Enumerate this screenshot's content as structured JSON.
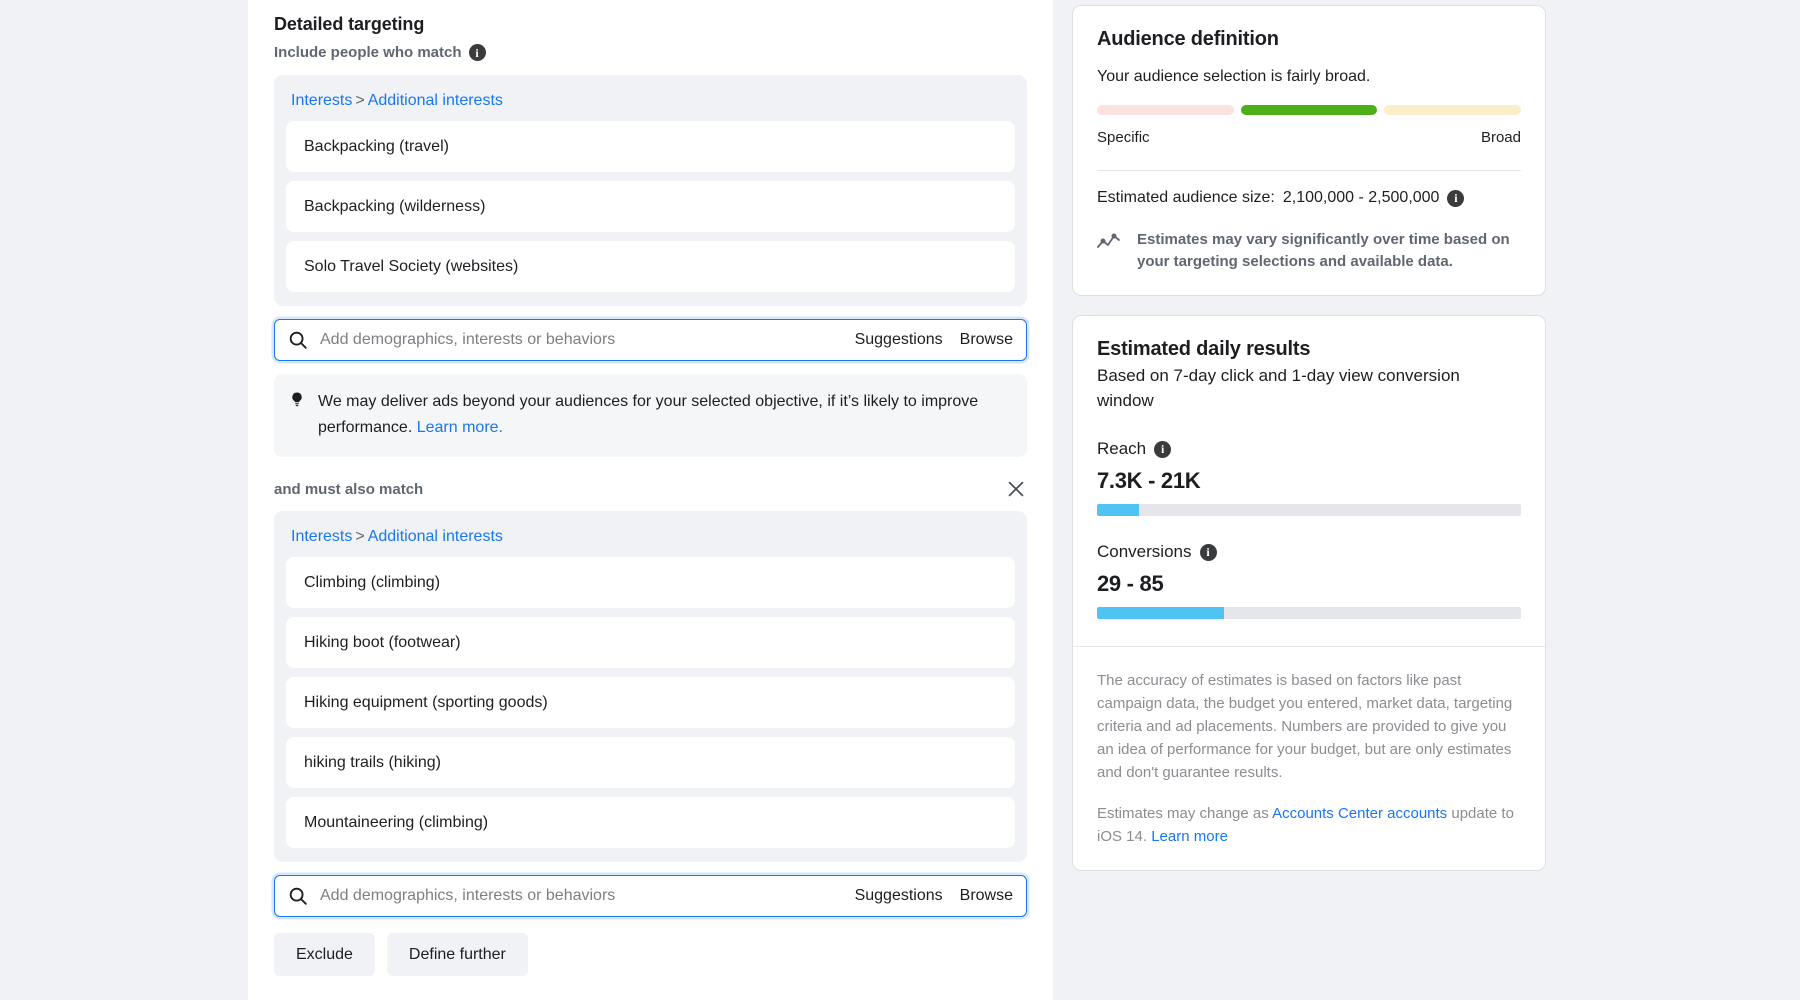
{
  "detailed_targeting": {
    "title": "Detailed targeting",
    "include_label": "Include people who match",
    "include_info_icon": "info-icon",
    "group1": {
      "breadcrumb_root": "Interests",
      "breadcrumb_sep": ">",
      "breadcrumb_leaf": "Additional interests",
      "items": [
        "Backpacking (travel)",
        "Backpacking (wilderness)",
        "Solo Travel Society (websites)"
      ],
      "search": {
        "icon": "search-icon",
        "placeholder": "Add demographics, interests or behaviors",
        "suggestions_label": "Suggestions",
        "browse_label": "Browse"
      }
    },
    "notice": {
      "icon": "lightbulb-icon",
      "text": "We may deliver ads beyond your audiences for your selected objective, if it’s likely to improve performance.",
      "link": "Learn more."
    },
    "and_must_also_match_label": "and must also match",
    "close_icon": "close-icon",
    "group2": {
      "breadcrumb_root": "Interests",
      "breadcrumb_sep": ">",
      "breadcrumb_leaf": "Additional interests",
      "items": [
        "Climbing (climbing)",
        "Hiking boot (footwear)",
        "Hiking equipment (sporting goods)",
        "hiking trails (hiking)",
        "Mountaineering (climbing)"
      ],
      "search": {
        "icon": "search-icon",
        "placeholder": "Add demographics, interests or behaviors",
        "suggestions_label": "Suggestions",
        "browse_label": "Browse"
      }
    },
    "buttons": {
      "exclude": "Exclude",
      "define_further": "Define further"
    }
  },
  "audience_definition": {
    "title": "Audience definition",
    "summary": "Your audience selection is fairly broad.",
    "meter": {
      "segments": [
        {
          "name": "specific",
          "color": "#fbe2e0",
          "active": false
        },
        {
          "name": "middle",
          "color": "#4caf17",
          "active": true
        },
        {
          "name": "broad",
          "color": "#fbeec8",
          "active": false
        }
      ],
      "left_label": "Specific",
      "right_label": "Broad"
    },
    "estimated_size_label": "Estimated audience size:",
    "estimated_size_value": "2,100,000 - 2,500,000",
    "estimated_size_info_icon": "info-icon",
    "vary_icon": "trend-chart-icon",
    "vary_text": "Estimates may vary significantly over time based on your targeting selections and available data."
  },
  "estimated_daily_results": {
    "title": "Estimated daily results",
    "subtitle": "Based on 7-day click and 1-day view conversion window",
    "metrics": [
      {
        "label": "Reach",
        "info_icon": "info-icon",
        "value": "7.3K - 21K",
        "fill_percent": 10,
        "fill_color": "#4fc3f1"
      },
      {
        "label": "Conversions",
        "info_icon": "info-icon",
        "value": "29 - 85",
        "fill_percent": 30,
        "fill_color": "#4fc3f1"
      }
    ],
    "accuracy_text": "The accuracy of estimates is based on factors like past campaign data, the budget you entered, market data, targeting criteria and ad placements. Numbers are provided to give you an idea of performance for your budget, but are only estimates and don't guarantee results.",
    "change_text_before": "Estimates may change as ",
    "change_link1": "Accounts Center accounts",
    "change_text_middle": " update to iOS 14. ",
    "change_link2": "Learn more"
  }
}
